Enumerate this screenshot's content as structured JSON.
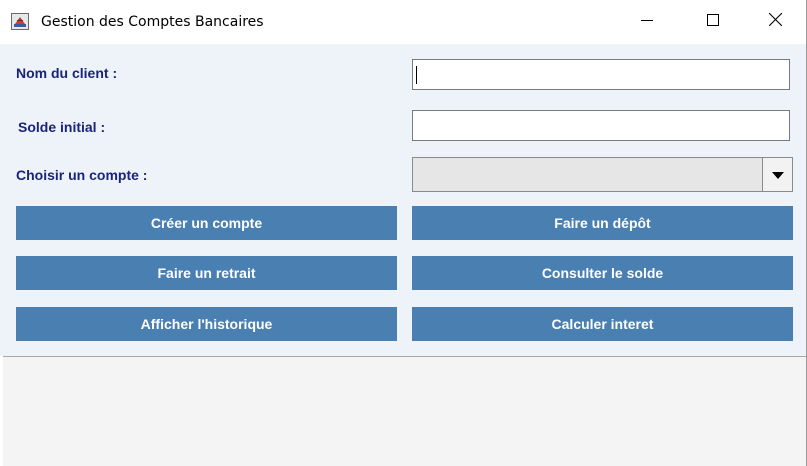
{
  "window": {
    "title": "Gestion des Comptes Bancaires",
    "icon": "java-coffee-cup-icon",
    "controls": [
      "minimize-icon",
      "maximize-icon",
      "close-icon"
    ]
  },
  "form": {
    "client_name_label": "Nom du client :",
    "client_name_value": "",
    "initial_balance_label": "Solde initial :",
    "initial_balance_value": "",
    "account_select_label": "Choisir un compte :",
    "account_select_value": ""
  },
  "buttons": {
    "create_account": "Créer un compte",
    "deposit": "Faire un dépôt",
    "withdraw": "Faire un retrait",
    "check_balance": "Consulter le solde",
    "show_history": "Afficher l'historique",
    "compute_interest": "Calculer interet"
  },
  "output": {
    "text": ""
  },
  "colors": {
    "label_text": "#1a2478",
    "button_bg": "#4a7fb1",
    "button_text": "#ffffff",
    "panel_bg": "#eef3fa",
    "output_bg": "#f4f4f4"
  }
}
